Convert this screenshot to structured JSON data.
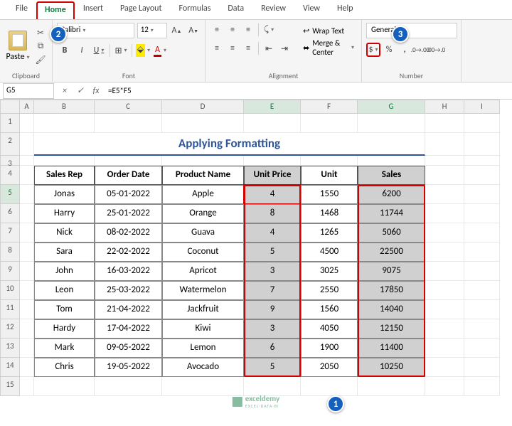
{
  "tabs": [
    "File",
    "Home",
    "Insert",
    "Page Layout",
    "Formulas",
    "Data",
    "Review",
    "View",
    "Help"
  ],
  "active_tab": "Home",
  "ribbon": {
    "clipboard": {
      "label": "Clipboard",
      "paste": "Paste"
    },
    "font": {
      "label": "Font",
      "name": "Calibri",
      "size": "12",
      "bold": "B",
      "italic": "I",
      "underline": "U"
    },
    "alignment": {
      "label": "Alignment",
      "wrap": "Wrap Text",
      "merge": "Merge & Center"
    },
    "number": {
      "label": "Number",
      "format": "General",
      "currency": "$",
      "percent": "%",
      "comma": ","
    }
  },
  "namebox": "G5",
  "formula": "=E5*F5",
  "columns": [
    "A",
    "B",
    "C",
    "D",
    "E",
    "F",
    "G",
    "H",
    "I"
  ],
  "selected_cols": [
    "E",
    "G"
  ],
  "title": "Applying Formatting",
  "headers": [
    "Sales Rep",
    "Order Date",
    "Product Name",
    "Unit Price",
    "Unit",
    "Sales"
  ],
  "data": [
    {
      "rep": "Jonas",
      "date": "05-01-2022",
      "prod": "Apple",
      "price": "4",
      "unit": "1550",
      "sales": "6200"
    },
    {
      "rep": "Harry",
      "date": "25-01-2022",
      "prod": "Orange",
      "price": "8",
      "unit": "1468",
      "sales": "11744"
    },
    {
      "rep": "Nick",
      "date": "08-02-2022",
      "prod": "Guava",
      "price": "4",
      "unit": "1265",
      "sales": "5060"
    },
    {
      "rep": "Sara",
      "date": "22-02-2022",
      "prod": "Coconut",
      "price": "5",
      "unit": "4500",
      "sales": "22500"
    },
    {
      "rep": "John",
      "date": "16-03-2022",
      "prod": "Apricot",
      "price": "3",
      "unit": "3025",
      "sales": "9075"
    },
    {
      "rep": "Leon",
      "date": "25-03-2022",
      "prod": "Watermelon",
      "price": "7",
      "unit": "2550",
      "sales": "17850"
    },
    {
      "rep": "Tom",
      "date": "21-04-2022",
      "prod": "Jackfruit",
      "price": "9",
      "unit": "1560",
      "sales": "14040"
    },
    {
      "rep": "Hardy",
      "date": "17-04-2022",
      "prod": "Kiwi",
      "price": "3",
      "unit": "4050",
      "sales": "12150"
    },
    {
      "rep": "Mark",
      "date": "09-05-2022",
      "prod": "Lemon",
      "price": "6",
      "unit": "1900",
      "sales": "11400"
    },
    {
      "rep": "Chris",
      "date": "19-05-2022",
      "prod": "Avocado",
      "price": "5",
      "unit": "2050",
      "sales": "10250"
    }
  ],
  "annotations": {
    "a1": "1",
    "a2": "2",
    "a3": "3"
  },
  "watermark": {
    "brand": "exceldemy",
    "sub": "EXCEL·DATA·BI"
  }
}
